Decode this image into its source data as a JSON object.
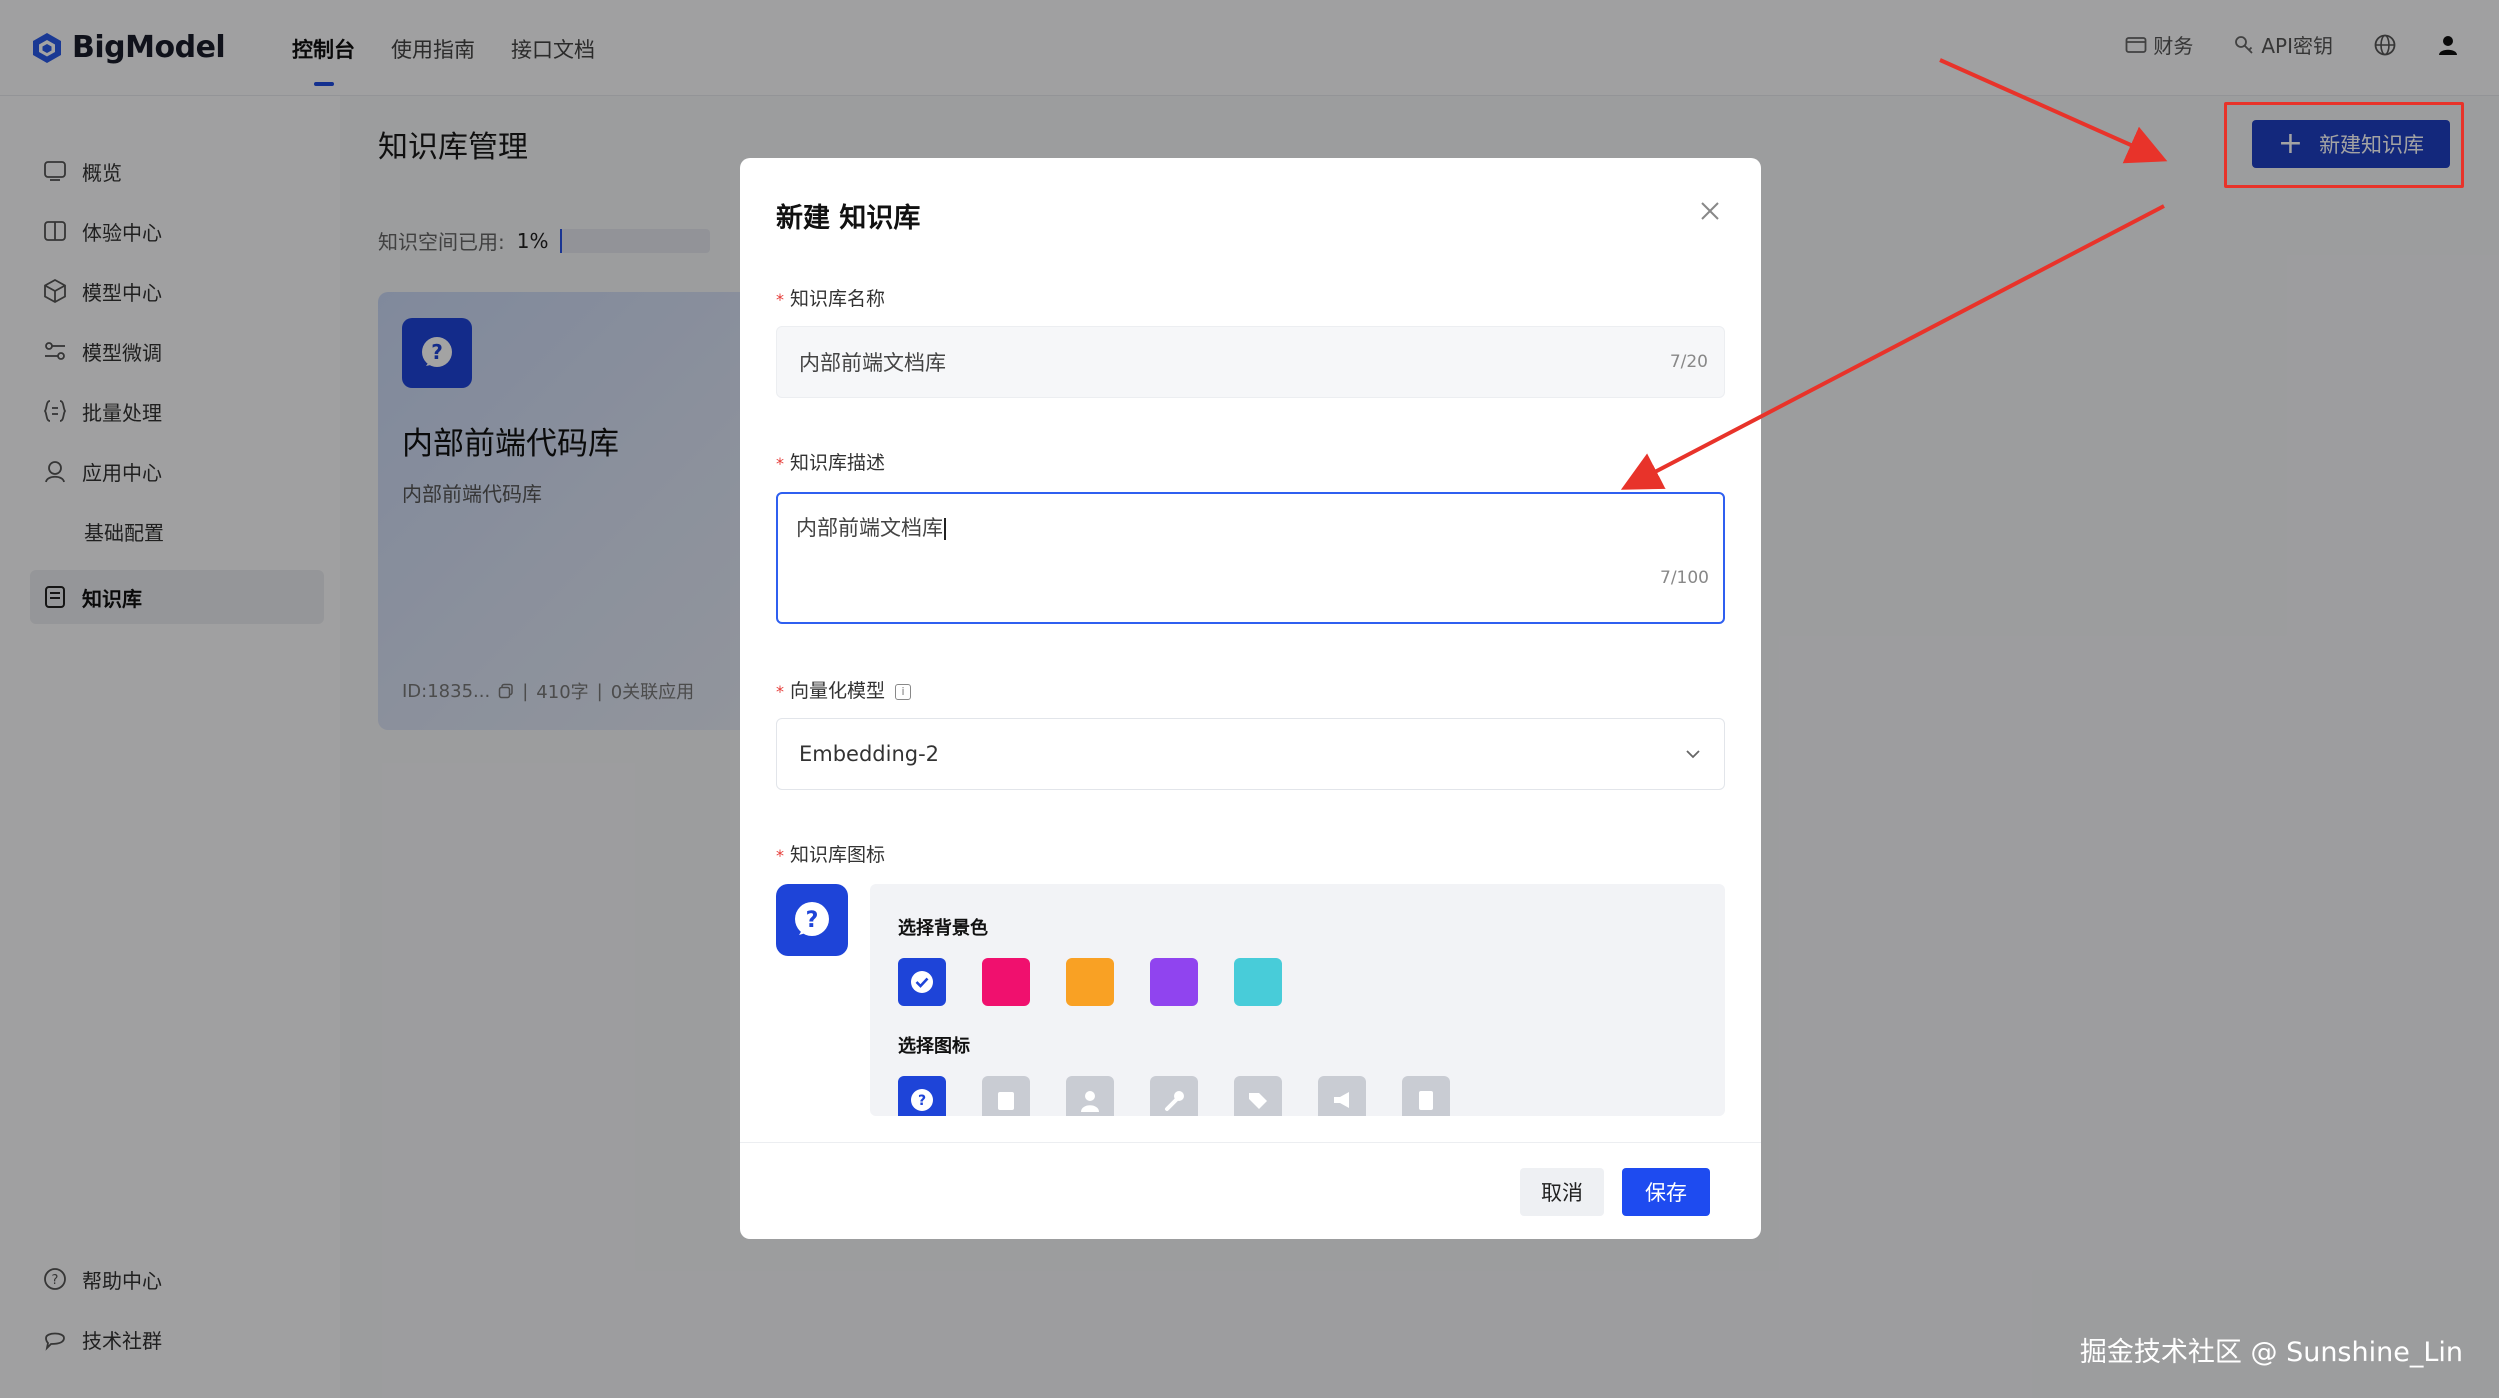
{
  "app": {
    "name": "BigModel"
  },
  "nav": {
    "tabs": [
      {
        "label": "控制台",
        "active": true
      },
      {
        "label": "使用指南",
        "active": false
      },
      {
        "label": "接口文档",
        "active": false
      }
    ]
  },
  "header_right": {
    "finance": "财务",
    "api_key": "API密钥"
  },
  "sidebar": {
    "items": [
      {
        "label": "概览",
        "icon": "monitor-icon"
      },
      {
        "label": "体验中心",
        "icon": "book-icon"
      },
      {
        "label": "模型中心",
        "icon": "cube-icon"
      },
      {
        "label": "模型微调",
        "icon": "tune-icon"
      },
      {
        "label": "批量处理",
        "icon": "braces-icon"
      },
      {
        "label": "应用中心",
        "icon": "app-icon"
      },
      {
        "label": "基础配置",
        "icon": ""
      },
      {
        "label": "知识库",
        "icon": "knowledge-icon",
        "active": true
      }
    ],
    "bottom": [
      {
        "label": "帮助中心",
        "icon": "help-icon"
      },
      {
        "label": "技术社群",
        "icon": "chat-icon"
      }
    ]
  },
  "main": {
    "title": "知识库管理",
    "usage_label": "知识空间已用:",
    "usage_pct": "1%",
    "usage_fraction": 0.01,
    "new_button": "新建知识库"
  },
  "card": {
    "name": "内部前端代码库",
    "desc": "内部前端代码库",
    "id": "ID:1835...",
    "chars": "410字",
    "apps": "0关联应用"
  },
  "modal": {
    "title": "新建 知识库",
    "name_label": "知识库名称",
    "name_value": "内部前端文档库",
    "name_count": "7/20",
    "desc_label": "知识库描述",
    "desc_value": "内部前端文档库",
    "desc_count": "7/100",
    "model_label": "向量化模型",
    "model_value": "Embedding-2",
    "icon_label": "知识库图标",
    "bg_label": "选择背景色",
    "icon_pick_label": "选择图标",
    "colors": [
      "#1e44d8",
      "#f0106e",
      "#f9a124",
      "#9044ef",
      "#48ccd9"
    ],
    "cancel": "取消",
    "save": "保存"
  },
  "accent": "#1e4be0",
  "annotation_color": "#e8332a",
  "watermark": "掘金技术社区 @ Sunshine_Lin"
}
